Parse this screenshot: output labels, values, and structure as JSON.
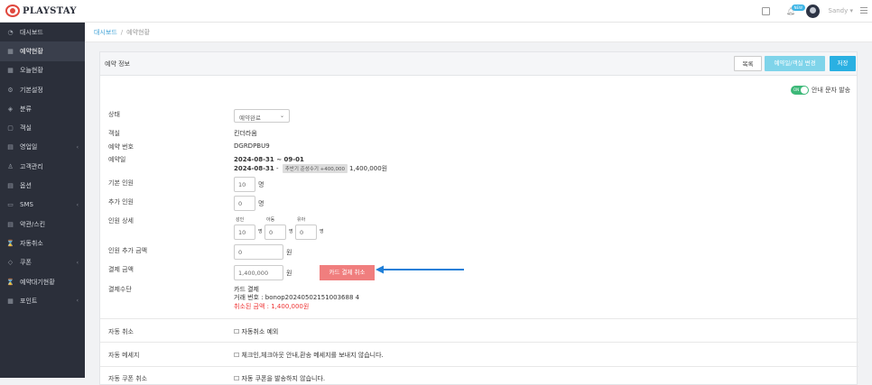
{
  "brand": {
    "name": "PLAYSTAY"
  },
  "sidebar": {
    "items": [
      {
        "label": "대시보드",
        "icon": "dashboard-icon",
        "glyph": "◔",
        "active": false,
        "caret": ""
      },
      {
        "label": "예약현황",
        "icon": "calendar-icon",
        "glyph": "▦",
        "active": true,
        "caret": ""
      },
      {
        "label": "오늘현황",
        "icon": "calendar-today-icon",
        "glyph": "▦",
        "active": false,
        "caret": ""
      },
      {
        "label": "기본설정",
        "icon": "gear-icon",
        "glyph": "⚙",
        "active": false,
        "caret": ""
      },
      {
        "label": "분류",
        "icon": "layers-icon",
        "glyph": "◈",
        "active": false,
        "caret": ""
      },
      {
        "label": "객실",
        "icon": "room-icon",
        "glyph": "▢",
        "active": false,
        "caret": ""
      },
      {
        "label": "영업일",
        "icon": "schedule-icon",
        "glyph": "▤",
        "active": false,
        "caret": "‹"
      },
      {
        "label": "고객관리",
        "icon": "user-icon",
        "glyph": "♙",
        "active": false,
        "caret": ""
      },
      {
        "label": "옵션",
        "icon": "option-icon",
        "glyph": "▤",
        "active": false,
        "caret": ""
      },
      {
        "label": "SMS",
        "icon": "message-icon",
        "glyph": "▭",
        "active": false,
        "caret": "‹"
      },
      {
        "label": "약관/스킨",
        "icon": "document-icon",
        "glyph": "▤",
        "active": false,
        "caret": ""
      },
      {
        "label": "자동취소",
        "icon": "hourglass-icon",
        "glyph": "⌛",
        "active": false,
        "caret": ""
      },
      {
        "label": "쿠폰",
        "icon": "tag-icon",
        "glyph": "◇",
        "active": false,
        "caret": "‹"
      },
      {
        "label": "예약대기현황",
        "icon": "hourglass-icon",
        "glyph": "⌛",
        "active": false,
        "caret": ""
      },
      {
        "label": "포인트",
        "icon": "point-icon",
        "glyph": "▦",
        "active": false,
        "caret": "‹"
      }
    ]
  },
  "topbar": {
    "badge": "NEW",
    "user": "Sandy ▾"
  },
  "breadcrumb": {
    "link": "대시보드",
    "separator": "/",
    "current": "예약현황"
  },
  "card": {
    "title": "예약 정보",
    "buttons": {
      "list": "목록",
      "change": "예약일/객실 변경",
      "save": "저장"
    }
  },
  "notice_toggle": {
    "state": "ON",
    "label": "안내 문자 발송"
  },
  "form": {
    "status": {
      "label": "상태",
      "value": "예약완료"
    },
    "room": {
      "label": "객실",
      "value": "킨더라움"
    },
    "reservation_no": {
      "label": "예약 번호",
      "value": "DGRDPBU9"
    },
    "date": {
      "label": "예약일",
      "line1": "2024-08-31 ~ 09-01",
      "line2_date": "2024-08-31",
      "line2_sep": " - ",
      "line2_tag": "추반기 준성수기 +400,000",
      "line2_price": "1,400,000원"
    },
    "base_people": {
      "label": "기본 인원",
      "value": "10",
      "unit": "명"
    },
    "extra_people": {
      "label": "추가 인원",
      "value": "0",
      "unit": "명"
    },
    "people_detail": {
      "label": "인원 상세",
      "adult": "성인",
      "child": "아동",
      "infant": "유아",
      "adult_val": "10",
      "child_val": "0",
      "infant_val": "0",
      "unit": "명"
    },
    "extra_fee": {
      "label": "인원 추가 금액",
      "value": "0",
      "unit": "원"
    },
    "pay_amount": {
      "label": "결제 금액",
      "value": "1,400,000",
      "unit": "원",
      "cancel_button": "카드 결제 취소"
    },
    "pay_method": {
      "label": "결제수단",
      "value": "카드 결제",
      "txn": "거래 번호 : bonop20240502151003688 4",
      "cancelled": "취소된 금액 : 1,400,000원"
    },
    "auto_cancel": {
      "label": "자동 취소",
      "option": "☐ 자동취소 예외"
    },
    "auto_message": {
      "label": "자동 메세지",
      "option": "☐ 체크인,체크아웃 안내,환송 메세지를 보내지 않습니다."
    },
    "auto_coupon": {
      "label": "자동 쿠폰 취소",
      "option": "☐ 자동 쿠폰을 발송하지 않습니다."
    }
  },
  "colors": {
    "accent": "#2ab0e2",
    "arrow": "#1f7fd8",
    "cancel": "#f07e7e"
  }
}
